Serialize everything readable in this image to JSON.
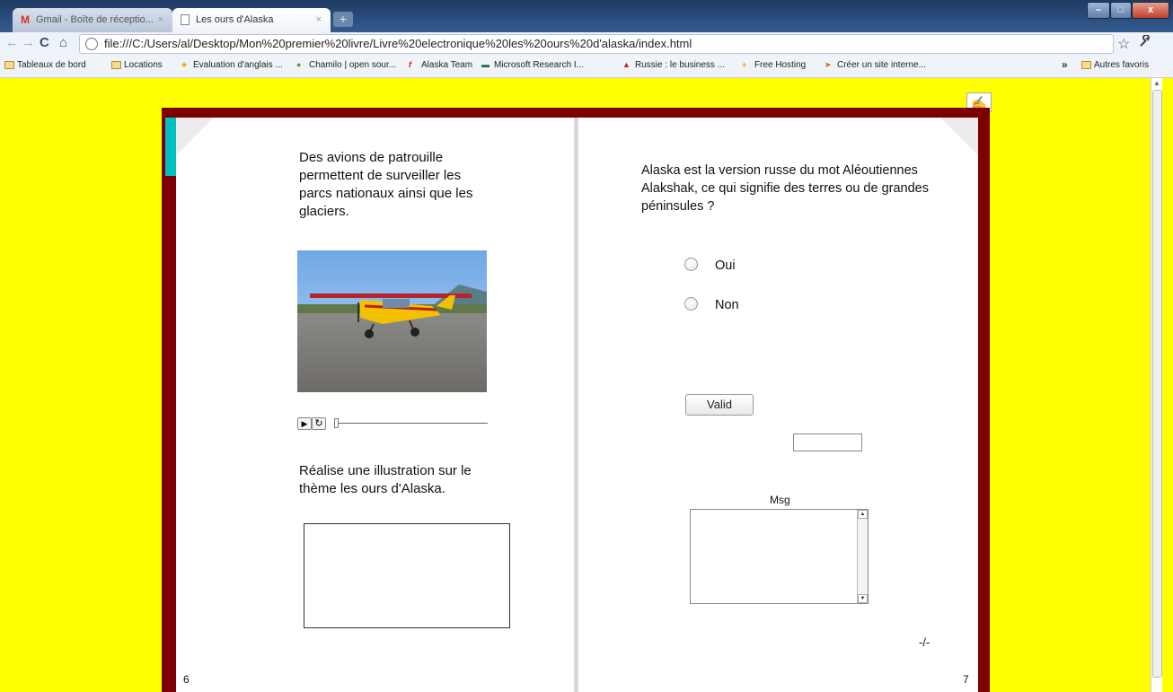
{
  "browser": {
    "tabs": [
      {
        "label": "Gmail - Boîte de réceptio...",
        "active": false,
        "icon": "gmail-icon"
      },
      {
        "label": "Les ours d'Alaska",
        "active": true,
        "icon": "page-icon"
      }
    ],
    "new_tab_label": "+",
    "window_buttons": {
      "minimize": "–",
      "maximize": "□",
      "close": "x"
    },
    "nav": {
      "back": "←",
      "forward": "→",
      "reload": "C",
      "home": "⌂"
    },
    "address": "file:///C:/Users/al/Desktop/Mon%20premier%20livre/Livre%20electronique%20les%20ours%20d'alaska/index.html",
    "star_icon": "☆",
    "wrench_icon": "🔧",
    "bookmarks": [
      {
        "label": "Tableaux de bord",
        "icon": "folder-icon"
      },
      {
        "label": "Locations",
        "icon": "folder-icon"
      },
      {
        "label": "Evaluation d'anglais ...",
        "icon": "star-icon"
      },
      {
        "label": "Chamilo | open sour...",
        "icon": "chamilo-icon"
      },
      {
        "label": "Alaska Team",
        "icon": "free-icon"
      },
      {
        "label": "Microsoft Research I...",
        "icon": "msr-icon"
      },
      {
        "label": "Russie : le business ...",
        "icon": "red-icon"
      },
      {
        "label": "Free Hosting",
        "icon": "plus-icon"
      },
      {
        "label": "Créer un site interne...",
        "icon": "arrow-icon"
      }
    ],
    "bookmarks_overflow": "»",
    "other_bookmarks": "Autres favoris"
  },
  "colors": {
    "page_background": "#ffff00",
    "book_cover": "#7d0000",
    "ribbon": "#00c0c0"
  },
  "book": {
    "left_page": {
      "paragraph": "Des avions de patrouille permettent de surveiller les parcs nationaux ainsi que les glaciers.",
      "image": "yellow-seaplane-photo",
      "player": {
        "play": "▶",
        "replay": "↻"
      },
      "prompt": "Réalise une illustration sur le thème les ours d'Alaska.",
      "page_number": "6"
    },
    "right_page": {
      "question": "Alaska est la version russe du mot Aléoutiennes Alakshak, ce qui signifie des terres ou de grandes péninsules ?",
      "options": [
        "Oui",
        "Non"
      ],
      "valid_button": "Valid",
      "result_value": "",
      "msg_label": "Msg",
      "msg_value": "",
      "pager": "-/-",
      "page_number": "7"
    },
    "edit_icon": "✍"
  }
}
